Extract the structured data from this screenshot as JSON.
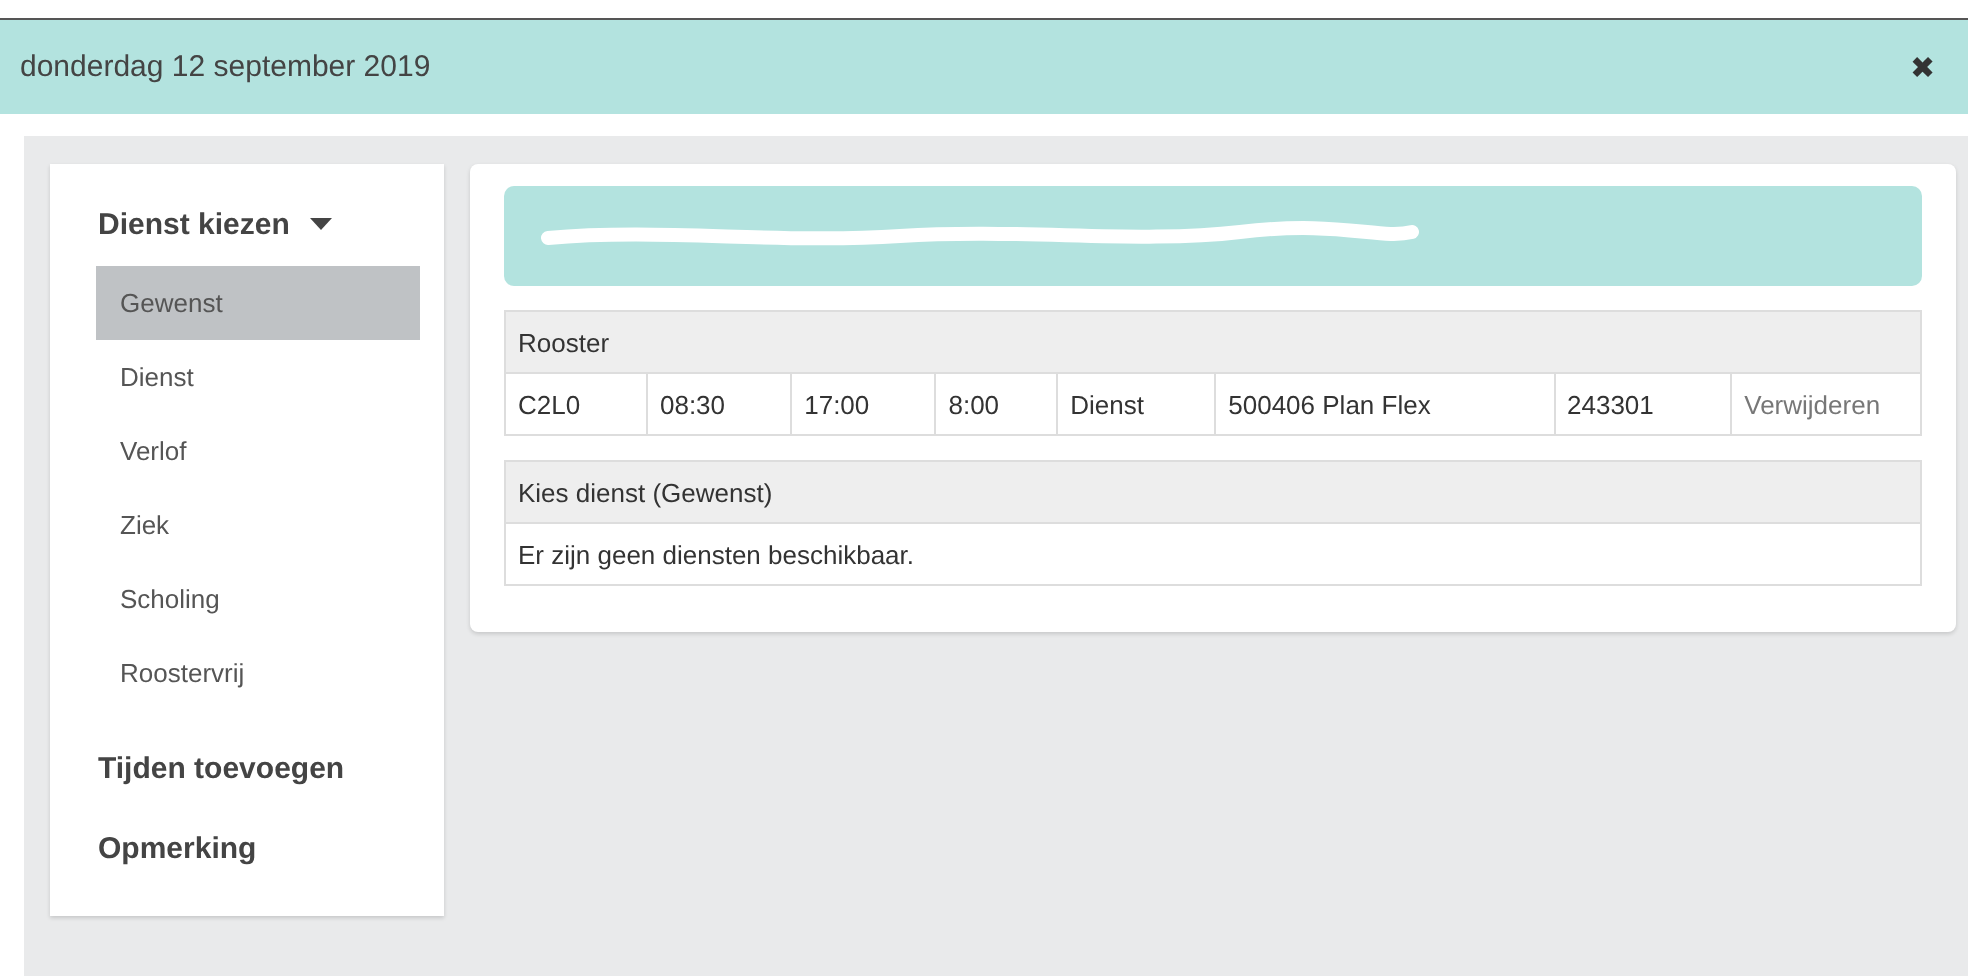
{
  "window": {
    "title": "donderdag 12 september 2019",
    "close": "✖"
  },
  "sidebar": {
    "sections": [
      {
        "label": "Dienst kiezen",
        "expanded": true,
        "items": [
          {
            "label": "Gewenst",
            "selected": true
          },
          {
            "label": "Dienst",
            "selected": false
          },
          {
            "label": "Verlof",
            "selected": false
          },
          {
            "label": "Ziek",
            "selected": false
          },
          {
            "label": "Scholing",
            "selected": false
          },
          {
            "label": "Roostervrij",
            "selected": false
          }
        ]
      },
      {
        "label": "Tijden toevoegen",
        "expanded": false
      },
      {
        "label": "Opmerking",
        "expanded": false
      }
    ]
  },
  "banner": {
    "kind": "redacted"
  },
  "rooster": {
    "title": "Rooster",
    "rows": [
      [
        "C2L0",
        "08:30",
        "17:00",
        "8:00",
        "Dienst",
        "500406 Plan Flex",
        "243301",
        "Verwijderen"
      ]
    ]
  },
  "choice": {
    "title": "Kies dienst (Gewenst)",
    "message": "Er zijn geen diensten beschikbaar."
  }
}
